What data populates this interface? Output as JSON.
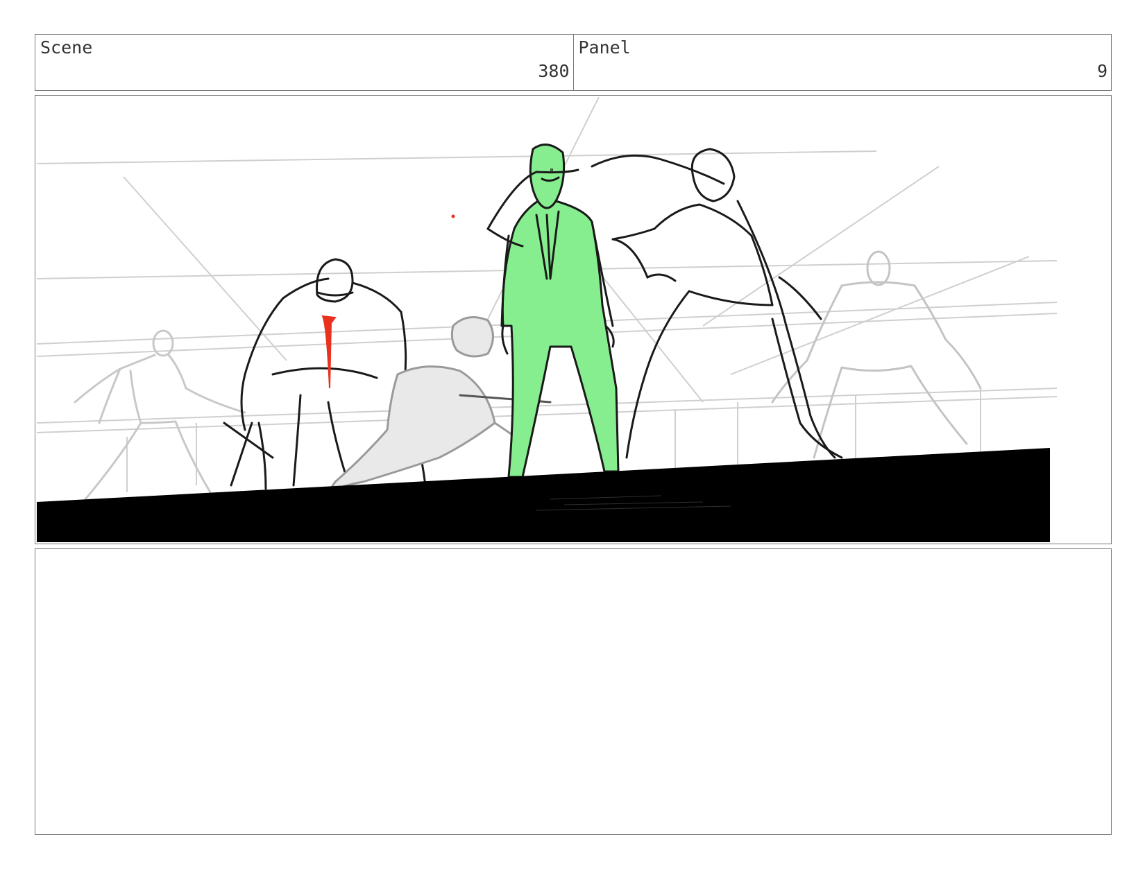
{
  "header": {
    "scene_label": "Scene",
    "scene_value": "380",
    "panel_label": "Panel",
    "panel_value": "9"
  },
  "colors": {
    "green_fill": "#86ee8e",
    "red_accent": "#e8321e",
    "sketch_dark": "#1a1a1a",
    "sketch_light": "#bdbdbd"
  },
  "notes": {
    "text": ""
  }
}
